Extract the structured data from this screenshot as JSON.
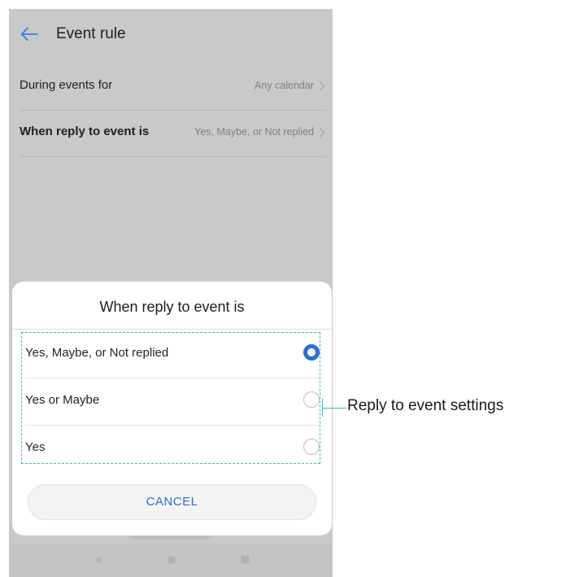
{
  "header": {
    "title": "Event rule",
    "back_icon": "arrow-left-icon",
    "back_color": "#3d7de0"
  },
  "settings": [
    {
      "label": "During events for",
      "value": "Any calendar"
    },
    {
      "label": "When reply to event is",
      "value": "Yes, Maybe, or Not replied"
    }
  ],
  "dialog": {
    "title": "When reply to event is",
    "options": [
      {
        "label": "Yes, Maybe, or Not replied",
        "selected": true
      },
      {
        "label": "Yes or Maybe",
        "selected": false
      },
      {
        "label": "Yes",
        "selected": false
      }
    ],
    "cancel_label": "CANCEL",
    "accent_color": "#2f6fd6"
  },
  "annotation": {
    "label": "Reply to event settings",
    "color": "#3cb8c0"
  },
  "nav_bar": {
    "icons": [
      "nav-back-icon",
      "nav-home-icon",
      "nav-recent-icon"
    ]
  }
}
